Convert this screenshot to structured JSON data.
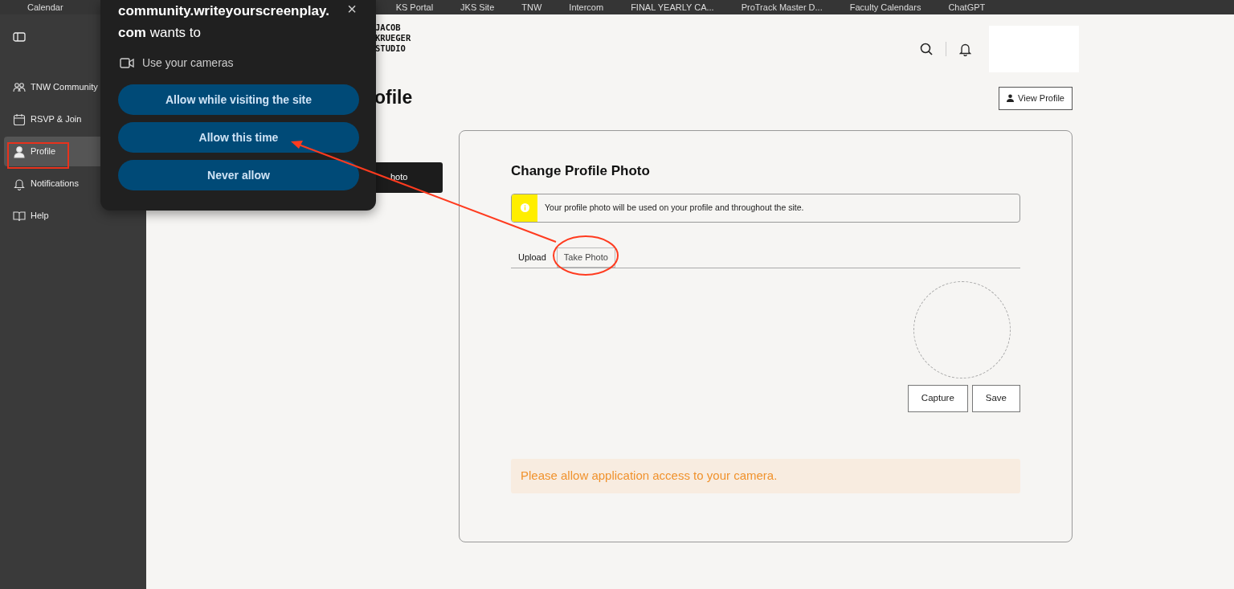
{
  "bookmarks": [
    {
      "label": "Calendar"
    },
    {
      "label": "KS Portal"
    },
    {
      "label": "JKS Site"
    },
    {
      "label": "TNW"
    },
    {
      "label": "Intercom"
    },
    {
      "label": "FINAL YEARLY CA..."
    },
    {
      "label": "ProTrack Master D..."
    },
    {
      "label": "Faculty Calendars"
    },
    {
      "label": "ChatGPT"
    }
  ],
  "sidebar": {
    "items": [
      {
        "label": "TNW Community",
        "selected": false
      },
      {
        "label": "RSVP & Join",
        "selected": false
      },
      {
        "label": "Profile",
        "selected": true
      },
      {
        "label": "Notifications",
        "selected": false
      },
      {
        "label": "Help",
        "selected": false
      }
    ]
  },
  "header": {
    "logo_lines": [
      "JACOB",
      "KRUEGER",
      "STUDIO"
    ]
  },
  "page": {
    "heading": "ofile",
    "view_profile_button": "View Profile",
    "side_button": "hoto"
  },
  "card": {
    "title": "Change Profile Photo",
    "info": "Your profile photo will be used on your profile and throughout the site.",
    "tabs": [
      {
        "label": "Upload",
        "selected": false
      },
      {
        "label": "Take Photo",
        "selected": true
      }
    ],
    "buttons": [
      "Capture",
      "Save"
    ],
    "warning": "Please allow application access to your camera."
  },
  "permission_dialog": {
    "close": "×",
    "title": "**community.writeyourscreenplay.com** wants to",
    "permission": "Use your cameras",
    "buttons": [
      "Allow while visiting the site",
      "Allow this time",
      "Never allow"
    ]
  }
}
